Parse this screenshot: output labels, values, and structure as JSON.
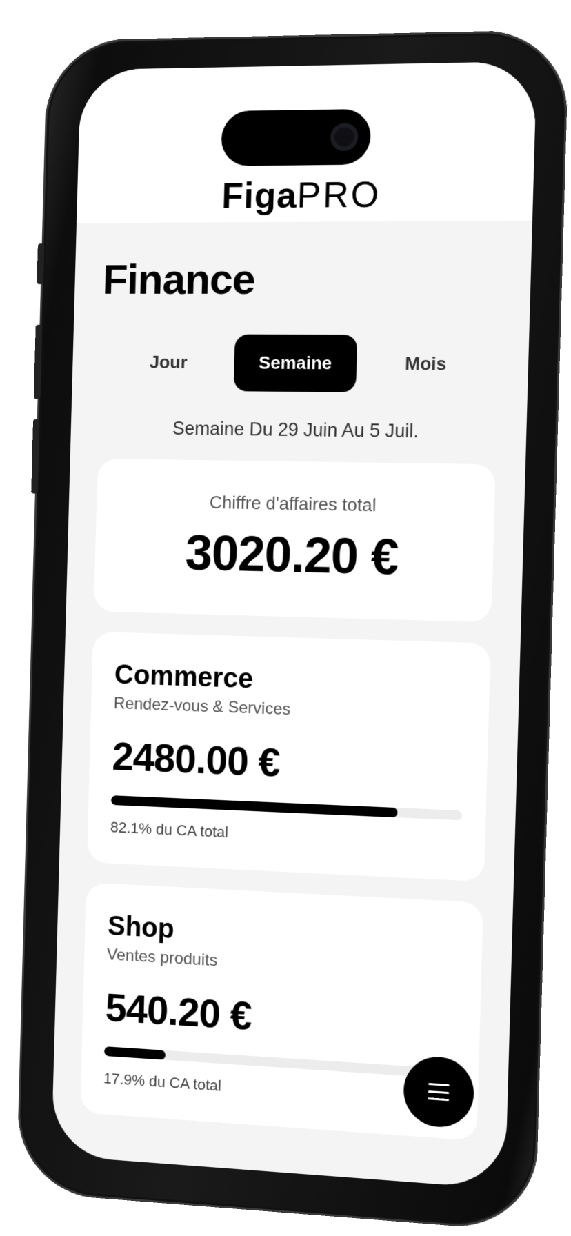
{
  "app": {
    "brand_bold": "Figa",
    "brand_light": "PRO"
  },
  "page": {
    "title": "Finance"
  },
  "tabs": [
    {
      "label": "Jour",
      "active": false
    },
    {
      "label": "Semaine",
      "active": true
    },
    {
      "label": "Mois",
      "active": false
    }
  ],
  "period": {
    "label": "Semaine Du 29 Juin Au 5 Juil."
  },
  "total": {
    "label": "Chiffre d'affaires total",
    "amount": "3020.20 €"
  },
  "segments": [
    {
      "title": "Commerce",
      "subtitle": "Rendez-vous & Services",
      "amount": "2480.00 €",
      "share": 0.821,
      "share_label": "82.1% du CA total"
    },
    {
      "title": "Shop",
      "subtitle": "Ventes produits",
      "amount": "540.20 €",
      "share": 0.179,
      "share_label": "17.9% du CA total"
    }
  ],
  "fab": {
    "icon": "menu-icon"
  },
  "colors": {
    "accent": "#000000",
    "background": "#f4f4f4",
    "card": "#ffffff",
    "bar_track": "#ececec"
  }
}
